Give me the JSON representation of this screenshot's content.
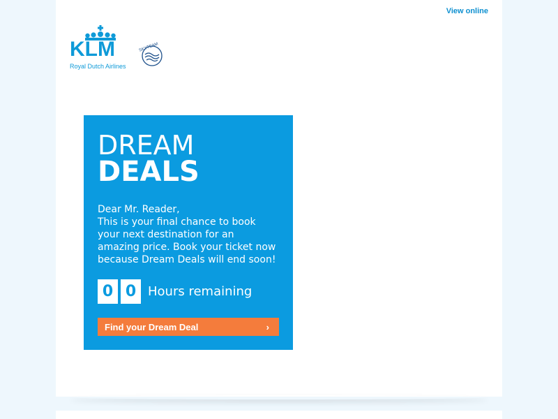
{
  "header": {
    "view_online": "View online"
  },
  "logo": {
    "wordmark": "KLM",
    "tagline": "Royal Dutch Airlines",
    "alliance": "SKYTEAM"
  },
  "promo": {
    "title_light": "DREAM",
    "title_bold": "DEALS",
    "message_lines": [
      "Dear Mr. Reader,",
      "This is your final chance to book",
      "your next destination for an",
      "amazing price. Book your ticket now",
      "because Dream Deals will end soon!"
    ],
    "countdown": {
      "digits": [
        "0",
        "0"
      ],
      "label": "Hours remaining"
    },
    "cta_label": "Find your Dream Deal",
    "cta_icon": "chevron-right-icon"
  },
  "colors": {
    "page_bg": "#eef7fd",
    "brand_blue": "#0b9be0",
    "cta_orange": "#f47c3c"
  }
}
